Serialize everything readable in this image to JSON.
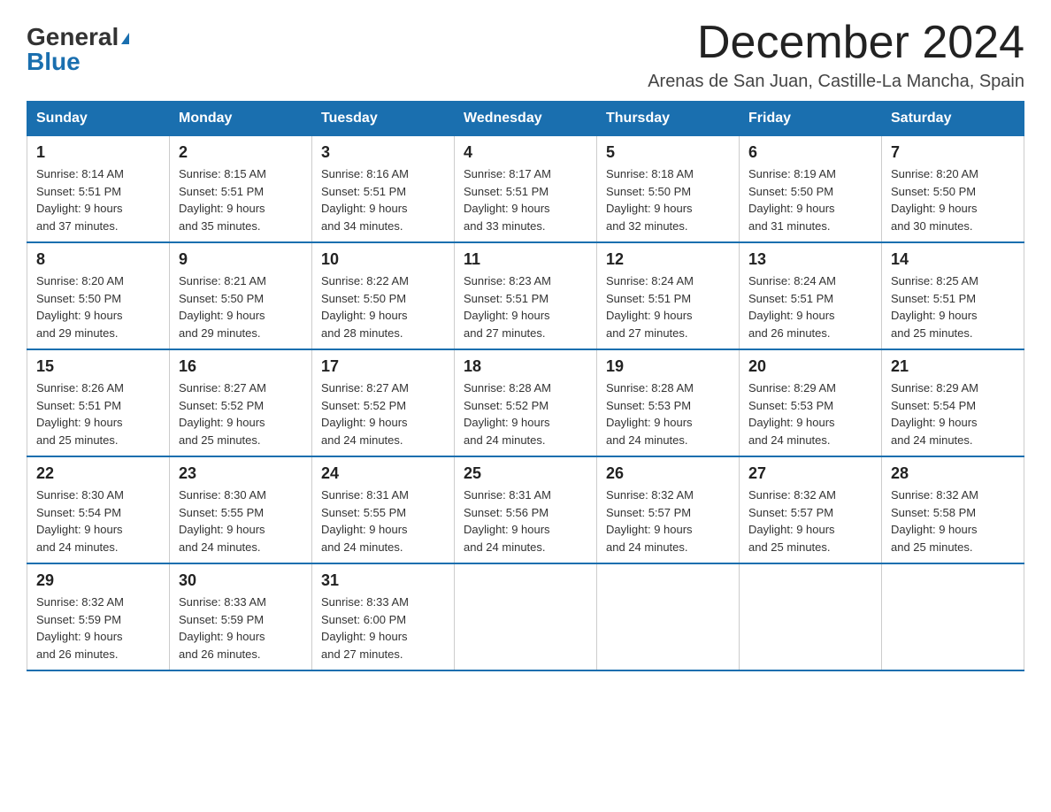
{
  "logo": {
    "general": "General",
    "triangle": "▲",
    "blue": "Blue"
  },
  "title": "December 2024",
  "subtitle": "Arenas de San Juan, Castille-La Mancha, Spain",
  "days_of_week": [
    "Sunday",
    "Monday",
    "Tuesday",
    "Wednesday",
    "Thursday",
    "Friday",
    "Saturday"
  ],
  "weeks": [
    [
      {
        "day": "1",
        "sunrise": "8:14 AM",
        "sunset": "5:51 PM",
        "daylight": "9 hours and 37 minutes."
      },
      {
        "day": "2",
        "sunrise": "8:15 AM",
        "sunset": "5:51 PM",
        "daylight": "9 hours and 35 minutes."
      },
      {
        "day": "3",
        "sunrise": "8:16 AM",
        "sunset": "5:51 PM",
        "daylight": "9 hours and 34 minutes."
      },
      {
        "day": "4",
        "sunrise": "8:17 AM",
        "sunset": "5:51 PM",
        "daylight": "9 hours and 33 minutes."
      },
      {
        "day": "5",
        "sunrise": "8:18 AM",
        "sunset": "5:50 PM",
        "daylight": "9 hours and 32 minutes."
      },
      {
        "day": "6",
        "sunrise": "8:19 AM",
        "sunset": "5:50 PM",
        "daylight": "9 hours and 31 minutes."
      },
      {
        "day": "7",
        "sunrise": "8:20 AM",
        "sunset": "5:50 PM",
        "daylight": "9 hours and 30 minutes."
      }
    ],
    [
      {
        "day": "8",
        "sunrise": "8:20 AM",
        "sunset": "5:50 PM",
        "daylight": "9 hours and 29 minutes."
      },
      {
        "day": "9",
        "sunrise": "8:21 AM",
        "sunset": "5:50 PM",
        "daylight": "9 hours and 29 minutes."
      },
      {
        "day": "10",
        "sunrise": "8:22 AM",
        "sunset": "5:50 PM",
        "daylight": "9 hours and 28 minutes."
      },
      {
        "day": "11",
        "sunrise": "8:23 AM",
        "sunset": "5:51 PM",
        "daylight": "9 hours and 27 minutes."
      },
      {
        "day": "12",
        "sunrise": "8:24 AM",
        "sunset": "5:51 PM",
        "daylight": "9 hours and 27 minutes."
      },
      {
        "day": "13",
        "sunrise": "8:24 AM",
        "sunset": "5:51 PM",
        "daylight": "9 hours and 26 minutes."
      },
      {
        "day": "14",
        "sunrise": "8:25 AM",
        "sunset": "5:51 PM",
        "daylight": "9 hours and 25 minutes."
      }
    ],
    [
      {
        "day": "15",
        "sunrise": "8:26 AM",
        "sunset": "5:51 PM",
        "daylight": "9 hours and 25 minutes."
      },
      {
        "day": "16",
        "sunrise": "8:27 AM",
        "sunset": "5:52 PM",
        "daylight": "9 hours and 25 minutes."
      },
      {
        "day": "17",
        "sunrise": "8:27 AM",
        "sunset": "5:52 PM",
        "daylight": "9 hours and 24 minutes."
      },
      {
        "day": "18",
        "sunrise": "8:28 AM",
        "sunset": "5:52 PM",
        "daylight": "9 hours and 24 minutes."
      },
      {
        "day": "19",
        "sunrise": "8:28 AM",
        "sunset": "5:53 PM",
        "daylight": "9 hours and 24 minutes."
      },
      {
        "day": "20",
        "sunrise": "8:29 AM",
        "sunset": "5:53 PM",
        "daylight": "9 hours and 24 minutes."
      },
      {
        "day": "21",
        "sunrise": "8:29 AM",
        "sunset": "5:54 PM",
        "daylight": "9 hours and 24 minutes."
      }
    ],
    [
      {
        "day": "22",
        "sunrise": "8:30 AM",
        "sunset": "5:54 PM",
        "daylight": "9 hours and 24 minutes."
      },
      {
        "day": "23",
        "sunrise": "8:30 AM",
        "sunset": "5:55 PM",
        "daylight": "9 hours and 24 minutes."
      },
      {
        "day": "24",
        "sunrise": "8:31 AM",
        "sunset": "5:55 PM",
        "daylight": "9 hours and 24 minutes."
      },
      {
        "day": "25",
        "sunrise": "8:31 AM",
        "sunset": "5:56 PM",
        "daylight": "9 hours and 24 minutes."
      },
      {
        "day": "26",
        "sunrise": "8:32 AM",
        "sunset": "5:57 PM",
        "daylight": "9 hours and 24 minutes."
      },
      {
        "day": "27",
        "sunrise": "8:32 AM",
        "sunset": "5:57 PM",
        "daylight": "9 hours and 25 minutes."
      },
      {
        "day": "28",
        "sunrise": "8:32 AM",
        "sunset": "5:58 PM",
        "daylight": "9 hours and 25 minutes."
      }
    ],
    [
      {
        "day": "29",
        "sunrise": "8:32 AM",
        "sunset": "5:59 PM",
        "daylight": "9 hours and 26 minutes."
      },
      {
        "day": "30",
        "sunrise": "8:33 AM",
        "sunset": "5:59 PM",
        "daylight": "9 hours and 26 minutes."
      },
      {
        "day": "31",
        "sunrise": "8:33 AM",
        "sunset": "6:00 PM",
        "daylight": "9 hours and 27 minutes."
      },
      null,
      null,
      null,
      null
    ]
  ],
  "labels": {
    "sunrise": "Sunrise:",
    "sunset": "Sunset:",
    "daylight": "Daylight:"
  }
}
